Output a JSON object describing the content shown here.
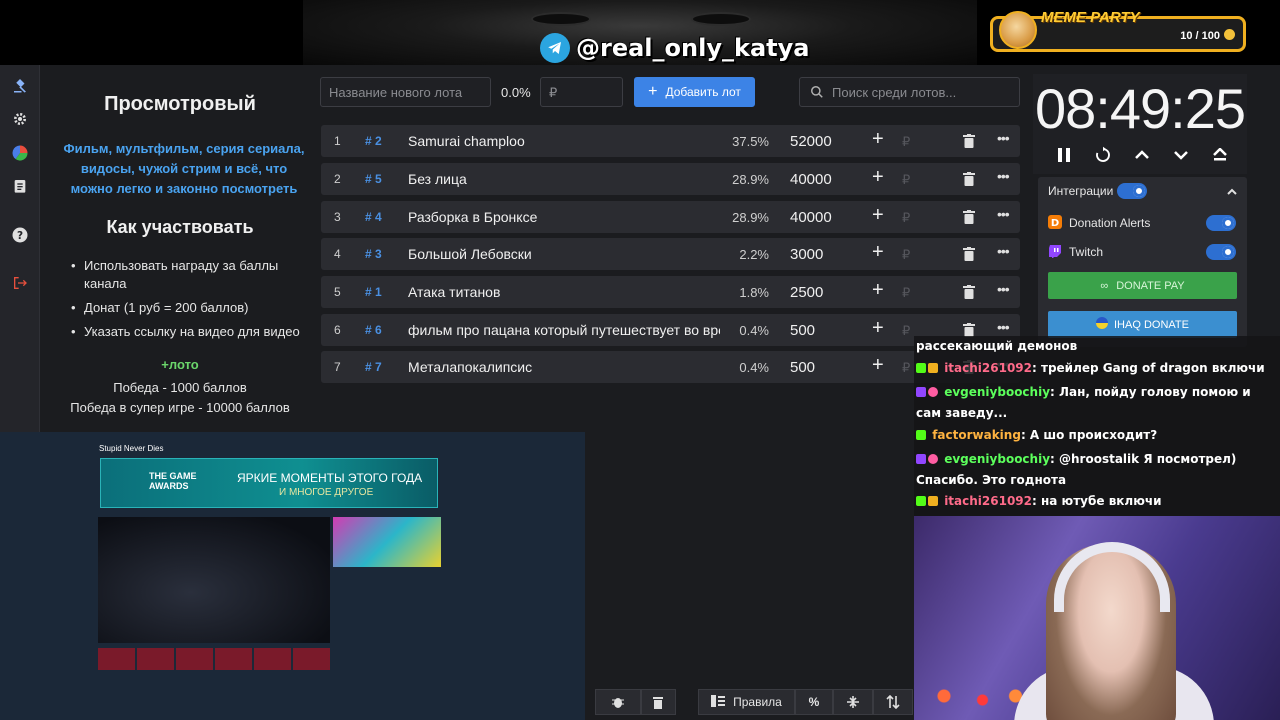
{
  "header": {
    "telegram_handle": "@real_only_katya",
    "meme_party": {
      "title": "MEME PARTY",
      "count": "10 / 100"
    }
  },
  "rail": {
    "icons": [
      "gavel-icon",
      "gear-icon",
      "pie-chart-icon",
      "clipboard-icon",
      "help-icon",
      "logout-icon"
    ]
  },
  "info": {
    "title": "Просмотровый",
    "description": "Фильм, мультфильм, серия сериала, видосы, чужой стрим и всё, что можно легко и законно посмотреть",
    "how_title": "Как участвовать",
    "items": [
      "Использовать награду за баллы канала",
      "Донат (1 руб = 200 баллов)",
      "Указать ссылку на видео для видео"
    ],
    "lot_label": "+лото",
    "win1": "Победа - 1000 баллов",
    "win2": "Победа в супер игре - 10000 баллов"
  },
  "toolbar": {
    "new_lot_placeholder": "Название нового лота",
    "total_pct": "0.0%",
    "amount_placeholder": "₽",
    "add_lot_label": "Добавить лот",
    "search_placeholder": "Поиск среди лотов..."
  },
  "lots": [
    {
      "idx": "1",
      "hash": "# 2",
      "name": "Samurai champloo",
      "pct": "37.5%",
      "amount": "52000",
      "plus": "+",
      "currency": "₽"
    },
    {
      "idx": "2",
      "hash": "# 5",
      "name": "Без лица",
      "pct": "28.9%",
      "amount": "40000",
      "plus": "+",
      "currency": "₽"
    },
    {
      "idx": "3",
      "hash": "# 4",
      "name": "Разборка в Бронксе",
      "pct": "28.9%",
      "amount": "40000",
      "plus": "+",
      "currency": "₽"
    },
    {
      "idx": "4",
      "hash": "# 3",
      "name": "Большой Лебовски",
      "pct": "2.2%",
      "amount": "3000",
      "plus": "+",
      "currency": "₽"
    },
    {
      "idx": "5",
      "hash": "# 1",
      "name": "Атака титанов",
      "pct": "1.8%",
      "amount": "2500",
      "plus": "+",
      "currency": "₽"
    },
    {
      "idx": "6",
      "hash": "# 6",
      "name": "фильм про пацана который путешествует во времени",
      "pct": "0.4%",
      "amount": "500",
      "plus": "+",
      "currency": "₽"
    },
    {
      "idx": "7",
      "hash": "# 7",
      "name": "Металапокалипсис",
      "pct": "0.4%",
      "amount": "500",
      "plus": "+",
      "currency": "₽"
    }
  ],
  "timer": {
    "value": "08:49:25"
  },
  "integrations": {
    "title": "Интеграции",
    "donation_alerts": "Donation Alerts",
    "twitch": "Twitch",
    "donate_pay": "DONATE PAY",
    "ihaq": "IHAQ DONATE"
  },
  "chat": {
    "lines": [
      {
        "user": "",
        "text": "рассекающий демонов",
        "color": "#ffffff"
      },
      {
        "user": "itachi261092",
        "text": ": трейлер Gang of dragon включи",
        "color": "#ff6b8a"
      },
      {
        "user": "evgeniyboochiy",
        "text": ": Лан, пойду голову помою и сам заведу...",
        "color": "#5cff5c"
      },
      {
        "user": "factorwaking",
        "text": ": А шо происходит?",
        "color": "#ffb340"
      },
      {
        "user": "evgeniyboochiy",
        "text": ": @hroostalik Я посмотрел) Спасибо. Это годнота",
        "color": "#5cff5c"
      },
      {
        "user": "itachi261092",
        "text": ": на ютубе включи",
        "color": "#ff6b8a"
      }
    ]
  },
  "steam": {
    "game_title": "Stupid Never Dies",
    "banner_text": "ЯРКИЕ МОМЕНТЫ ЭТОГО ГОДА",
    "banner_sub": "И МНОГОЕ ДРУГОЕ",
    "awards": "THE GAME AWARDS"
  },
  "bottom_bar": {
    "rules_label": "Правила",
    "percent_label": "%"
  }
}
